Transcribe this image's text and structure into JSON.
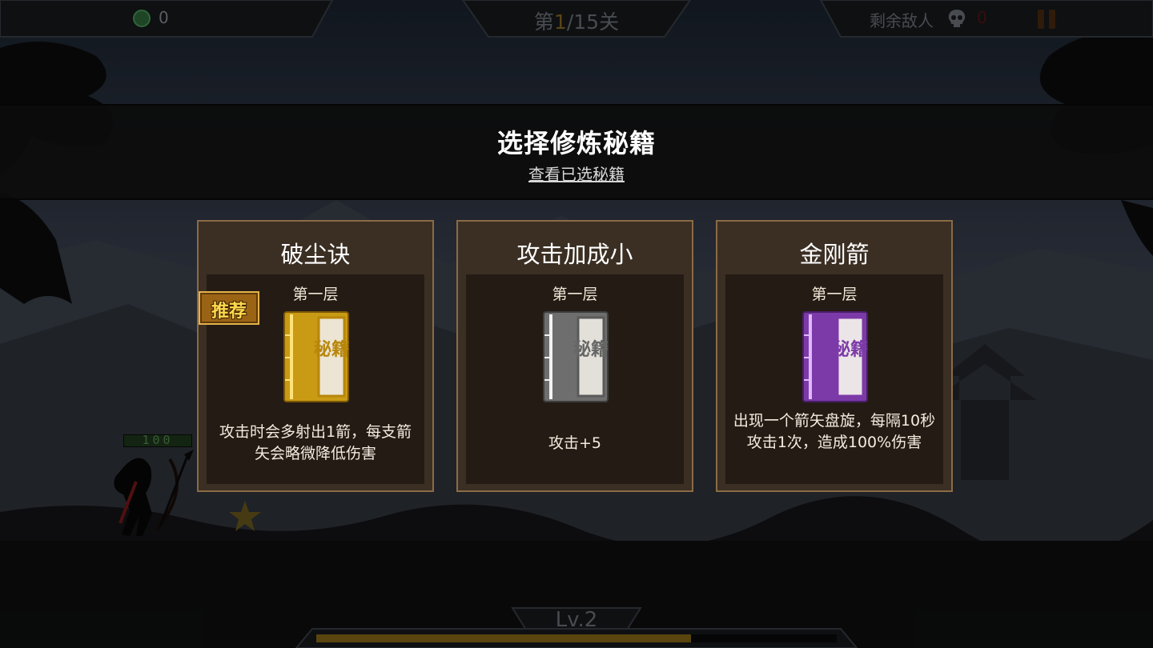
{
  "hud": {
    "coins": "0",
    "stage_prefix": "第",
    "stage_current": "1",
    "stage_suffix": "/15关",
    "enemies_label": "剩余敌人",
    "enemies_count": "0",
    "level_label": "Lv.2",
    "player_hp": "100",
    "xp_progress": 0.72
  },
  "dialog": {
    "title": "选择修炼秘籍",
    "view_selected_link": "查看已选秘籍"
  },
  "cards": [
    {
      "name": "破尘诀",
      "tier": "第一层",
      "book_label": "秘籍",
      "book_color": "#c99a14",
      "book_color_dark": "#8f6b08",
      "recommended": true,
      "badge": "推荐",
      "description": "攻击时会多射出1箭，每支箭矢会略微降低伤害"
    },
    {
      "name": "攻击加成小",
      "tier": "第一层",
      "book_label": "秘籍",
      "book_color": "#6e6e6e",
      "book_color_dark": "#4a4a4a",
      "recommended": false,
      "description": "攻击+5"
    },
    {
      "name": "金刚箭",
      "tier": "第一层",
      "book_label": "秘籍",
      "book_color": "#7c3aa8",
      "book_color_dark": "#552375",
      "recommended": false,
      "description": "出现一个箭矢盘旋，每隔10秒攻击1次，造成100%伤害"
    }
  ],
  "colors": {
    "card_bg": "#3b2f24",
    "card_border": "#8a6b45",
    "card_inner": "#241b14",
    "enemy_count_red": "#b01818",
    "stage_highlight": "#c9a23a"
  },
  "icons": [
    "coin-icon",
    "skull-icon",
    "pause-icon",
    "star-icon"
  ]
}
